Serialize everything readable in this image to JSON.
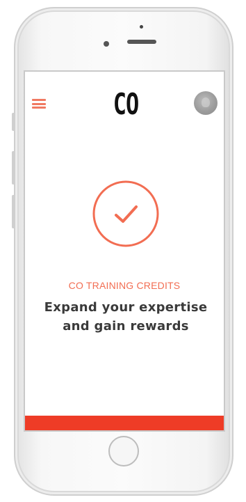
{
  "app": {
    "logo": "CO",
    "menu_icon": "hamburger-menu-icon",
    "avatar_icon": "user-avatar"
  },
  "hero": {
    "icon": "checkmark-circle-icon",
    "eyebrow": "CO TRAINING CREDITS",
    "headline": "Expand your expertise and gain rewards"
  },
  "colors": {
    "accent": "#f26d52",
    "bar": "#ee3c26",
    "headline_text": "#3a3a3a",
    "logo_text": "#111111"
  }
}
